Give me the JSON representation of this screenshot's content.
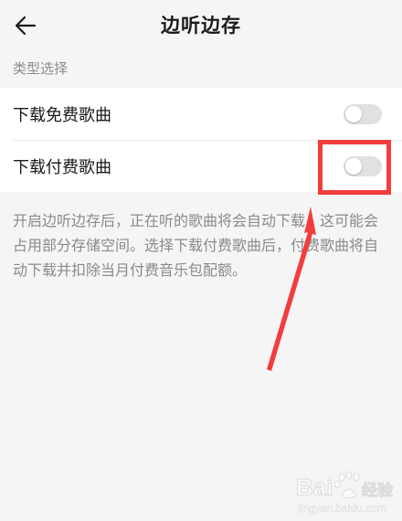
{
  "header": {
    "title": "边听边存",
    "back_icon": "arrow-left-icon"
  },
  "section": {
    "label": "类型选择"
  },
  "settings": [
    {
      "label": "下载免费歌曲",
      "enabled": false
    },
    {
      "label": "下载付费歌曲",
      "enabled": false
    }
  ],
  "description": "开启边听边存后，正在听的歌曲将会自动下载，这可能会占用部分存储空间。选择下载付费歌曲后，付费歌曲将自动下载并扣除当月付费音乐包配额。",
  "annotation": {
    "color": "#f23d3d",
    "icon": "arrow-pointer-icon"
  },
  "watermark": {
    "icon": "baidu-paw-logo",
    "brand": "Bai",
    "suffix": "经验",
    "url": "jingyan.baidu.com"
  }
}
